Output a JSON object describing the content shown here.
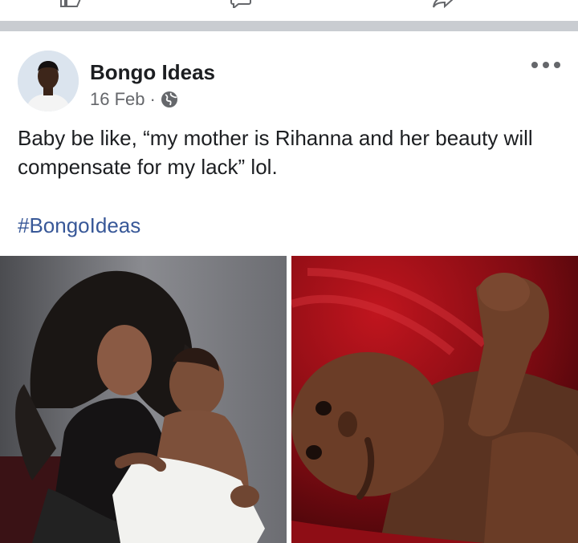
{
  "post": {
    "author": "Bongo Ideas",
    "date": "16 Feb",
    "separator": "·",
    "text": "Baby be like, “my mother is Rihanna and her beauty will compensate for my lack” lol.",
    "hashtag": "#BongoIdeas"
  },
  "icons": {
    "privacy": "globe-icon",
    "options": "more-horizontal-icon"
  },
  "colors": {
    "hashtag": "#385898",
    "meta": "#65676b",
    "band": "#c9ccd1"
  }
}
